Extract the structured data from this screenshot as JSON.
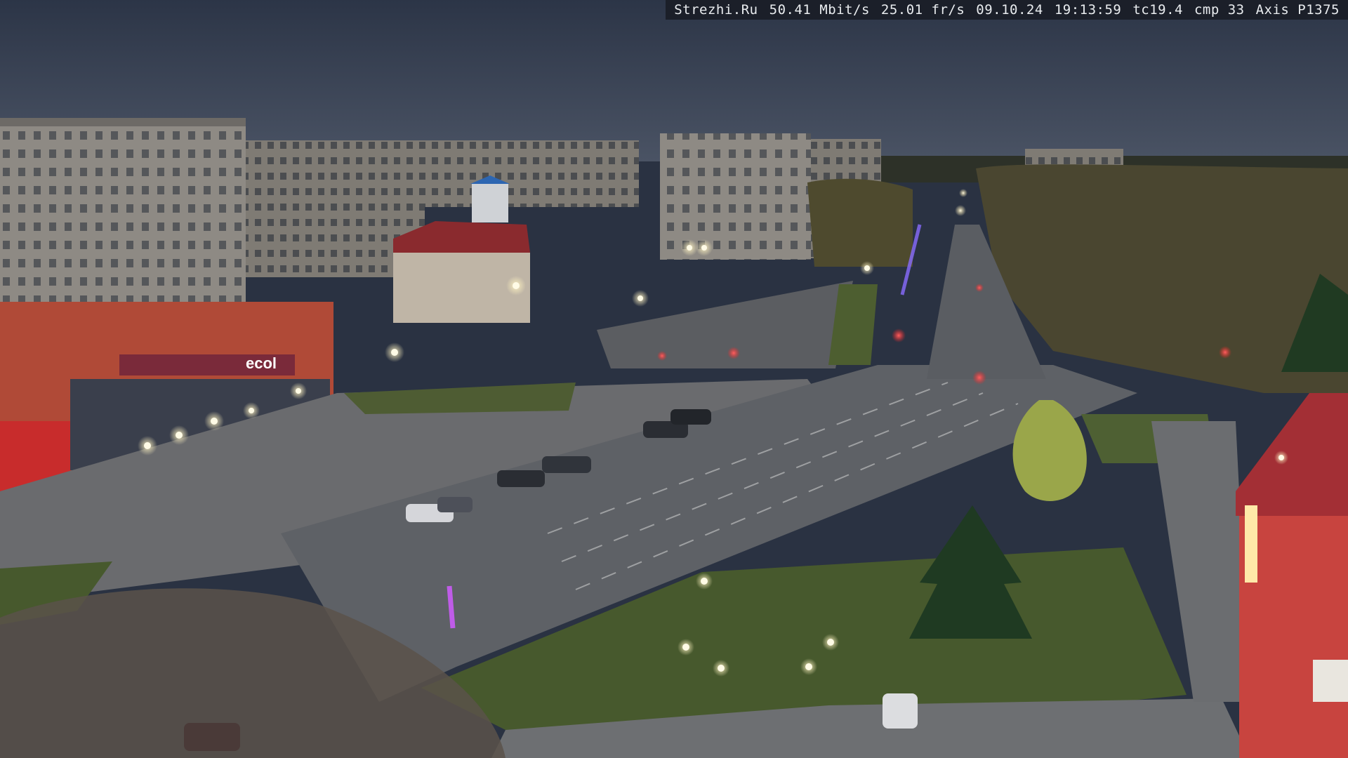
{
  "overlay": {
    "site": "Strezhi.Ru",
    "bitrate": "50.41 Mbit/s",
    "framerate": "25.01 fr/s",
    "date": "09.10.24",
    "time": "19:13:59",
    "tc": "tc19.4",
    "cmp": "cmp 33",
    "camera": "Axis P1375"
  },
  "signs": {
    "storefront": "ecol"
  },
  "colors": {
    "sky": "#3a4456",
    "road": "#5e6166",
    "grass": "#47592d",
    "streetlight": "#f4f1dc",
    "traffic_red": "#ff2a2a",
    "shop_wall": "#b04a37",
    "right_building": "#c8443f"
  }
}
